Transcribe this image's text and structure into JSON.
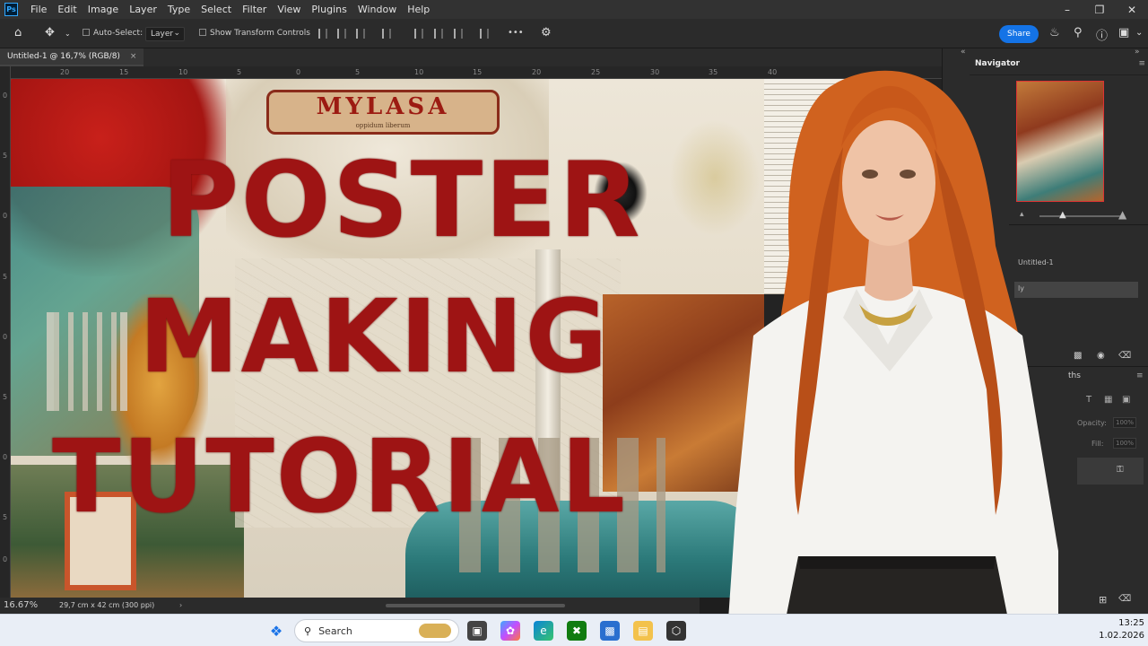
{
  "app": {
    "logo": "Ps",
    "menu": [
      "File",
      "Edit",
      "Image",
      "Layer",
      "Type",
      "Select",
      "Filter",
      "View",
      "Plugins",
      "Window",
      "Help"
    ]
  },
  "options_bar": {
    "auto_select_label": "Auto-Select:",
    "layer_value": "Layer",
    "show_transform_label": "Show Transform Controls",
    "more_label": "•••",
    "share_label": "Share"
  },
  "document": {
    "tab_title": "Untitled-1 @ 16,7% (RGB/8)",
    "close_label": "×",
    "ruler_top": [
      "20",
      "15",
      "10",
      "5",
      "0",
      "5",
      "10",
      "15",
      "20",
      "25",
      "30",
      "35",
      "40"
    ],
    "ruler_left": [
      "0",
      "5",
      "0",
      "5",
      "0",
      "5",
      "0",
      "5",
      "0",
      "5",
      "0"
    ]
  },
  "poster": {
    "banner_text": "MYLASA",
    "banner_subtext": "oppidum liberum",
    "title_lines": [
      "POSTER",
      "MAKING",
      "TUTORIAL"
    ],
    "colors": {
      "title": "#9e1414",
      "cream": "#ede6d8",
      "teal": "#2f7f7c",
      "rust": "#a9521f"
    }
  },
  "status": {
    "zoom": "16.67%",
    "doc_size": "29,7 cm x 42 cm (300 ppi)"
  },
  "panels": {
    "navigator_title": "Navigator",
    "layer_name": "Untitled-1",
    "layer_name_2": "ly",
    "paths_tab": "ths",
    "opacity_label": "Opacity:",
    "opacity_value": "100%",
    "fill_label": "Fill:",
    "fill_value": "100%"
  },
  "taskbar": {
    "search_placeholder": "Search",
    "time": "13:25",
    "date": "1.02.2026"
  }
}
